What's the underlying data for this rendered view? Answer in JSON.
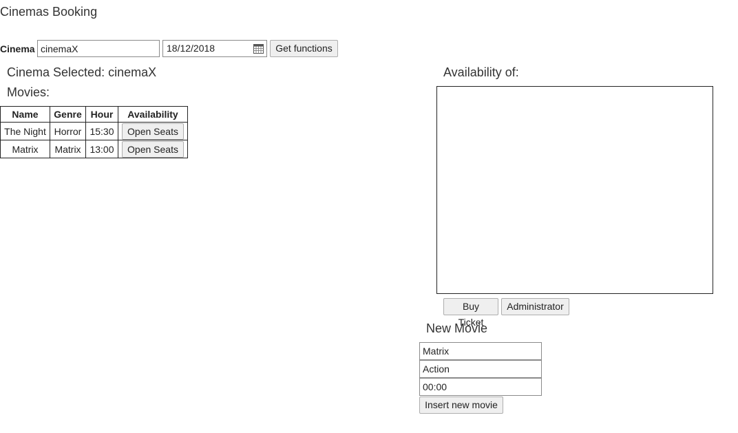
{
  "app": {
    "title": "Cinemas Booking"
  },
  "search": {
    "cinema_label": "Cinema",
    "cinema_value": "cinemaX",
    "date_value": "18/12/2018",
    "get_functions_label": "Get functions"
  },
  "selection": {
    "cinema_selected": "Cinema Selected: cinemaX",
    "movies_heading": "Movies:"
  },
  "movies_table": {
    "headers": [
      "Name",
      "Genre",
      "Hour",
      "Availability"
    ],
    "rows": [
      {
        "name": "The Night",
        "genre": "Horror",
        "hour": "15:30",
        "action": "Open Seats"
      },
      {
        "name": "Matrix",
        "genre": "Matrix",
        "hour": "13:00",
        "action": "Open Seats"
      }
    ]
  },
  "availability": {
    "heading": "Availability of:",
    "buy_ticket_label": "Buy Ticket",
    "administrator_label": "Administrator"
  },
  "new_movie": {
    "heading": "New Movie",
    "name_value": "Matrix",
    "genre_value": "Action",
    "hour_value": "00:00",
    "insert_label": "Insert new movie"
  },
  "icons": {
    "calendar": "calendar-icon"
  }
}
